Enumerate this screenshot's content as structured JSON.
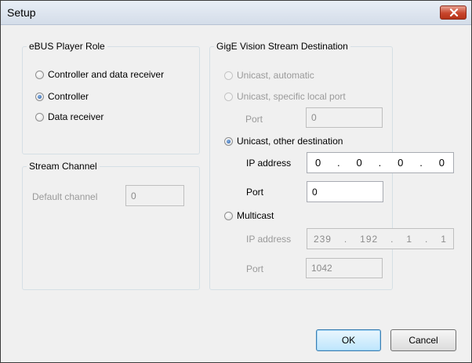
{
  "window": {
    "title": "Setup"
  },
  "role_group": {
    "legend": "eBUS Player Role",
    "options": [
      "Controller and data receiver",
      "Controller",
      "Data receiver"
    ],
    "selected": "Controller"
  },
  "stream_channel": {
    "legend": "Stream Channel",
    "default_channel_label": "Default channel",
    "default_channel_value": "0"
  },
  "destination_group": {
    "legend": "GigE Vision Stream Destination",
    "unicast_auto": "Unicast, automatic",
    "unicast_local_port": "Unicast, specific local port",
    "local_port_label": "Port",
    "local_port_value": "0",
    "unicast_other": "Unicast, other destination",
    "other_ip_label": "IP address",
    "other_ip": [
      "0",
      "0",
      "0",
      "0"
    ],
    "other_port_label": "Port",
    "other_port_value": "0",
    "multicast": "Multicast",
    "multicast_ip_label": "IP address",
    "multicast_ip": [
      "239",
      "192",
      "1",
      "1"
    ],
    "multicast_port_label": "Port",
    "multicast_port_value": "1042",
    "selected": "Unicast, other destination"
  },
  "buttons": {
    "ok": "OK",
    "cancel": "Cancel"
  },
  "colors": {
    "close_button": "#c8452c",
    "default_button_border": "#3c7fb1",
    "group_border": "#d5dfe5"
  }
}
